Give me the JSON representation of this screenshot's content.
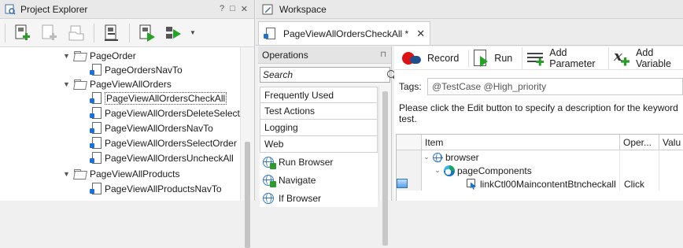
{
  "project_explorer": {
    "title": "Project Explorer",
    "controls": [
      "?",
      "□",
      "✕"
    ],
    "toolbar_icons": [
      "add-item-icon",
      "add-existing-icon",
      "open-folder-icon",
      "new-project-icon",
      "run-project-icon",
      "run-suite-icon",
      "dropdown-icon"
    ],
    "tree": [
      {
        "label": "PageOrder",
        "type": "folder",
        "expanded": true
      },
      {
        "label": "PageOrdersNavTo",
        "type": "keyword-test"
      },
      {
        "label": "PageViewAllOrders",
        "type": "folder",
        "expanded": true
      },
      {
        "label": "PageViewAllOrdersCheckAll",
        "type": "keyword-test",
        "selected": true
      },
      {
        "label": "PageViewAllOrdersDeleteSelected",
        "type": "keyword-test"
      },
      {
        "label": "PageViewAllOrdersNavTo",
        "type": "keyword-test"
      },
      {
        "label": "PageViewAllOrdersSelectOrder",
        "type": "keyword-test"
      },
      {
        "label": "PageViewAllOrdersUncheckAll",
        "type": "keyword-test"
      },
      {
        "label": "PageViewAllProducts",
        "type": "folder",
        "expanded": true
      },
      {
        "label": "PageViewAllProductsNavTo",
        "type": "keyword-test"
      }
    ]
  },
  "workspace": {
    "title": "Workspace",
    "tab": {
      "label": "PageViewAllOrdersCheckAll *",
      "close": "✕"
    },
    "operations": {
      "title": "Operations",
      "pin": "⊓",
      "search_placeholder": "Search",
      "categories": [
        "Frequently Used",
        "Test Actions",
        "Logging",
        "Web"
      ],
      "items": [
        "Run Browser",
        "Navigate",
        "If Browser"
      ]
    },
    "toolbar": {
      "record": "Record",
      "run": "Run",
      "add_parameter": "Add Parameter",
      "add_variable": "Add Variable"
    },
    "tags_label": "Tags:",
    "tags_value": "@TestCase @High_priority",
    "description": "Please click the Edit button to specify a description for the keyword test.",
    "grid": {
      "columns": [
        "Item",
        "Oper...",
        "Valu"
      ],
      "rows": [
        {
          "item": "browser",
          "operation": "",
          "icon": "globe-icon"
        },
        {
          "item": "pageComponents",
          "operation": "",
          "icon": "edge-icon"
        },
        {
          "item": "linkCtl00MaincontentBtncheckall",
          "operation": "Click",
          "icon": "target-icon"
        }
      ]
    }
  },
  "colors": {
    "accent_blue": "#1d70d6",
    "run_green": "#27a327",
    "record_red": "#d11111"
  }
}
